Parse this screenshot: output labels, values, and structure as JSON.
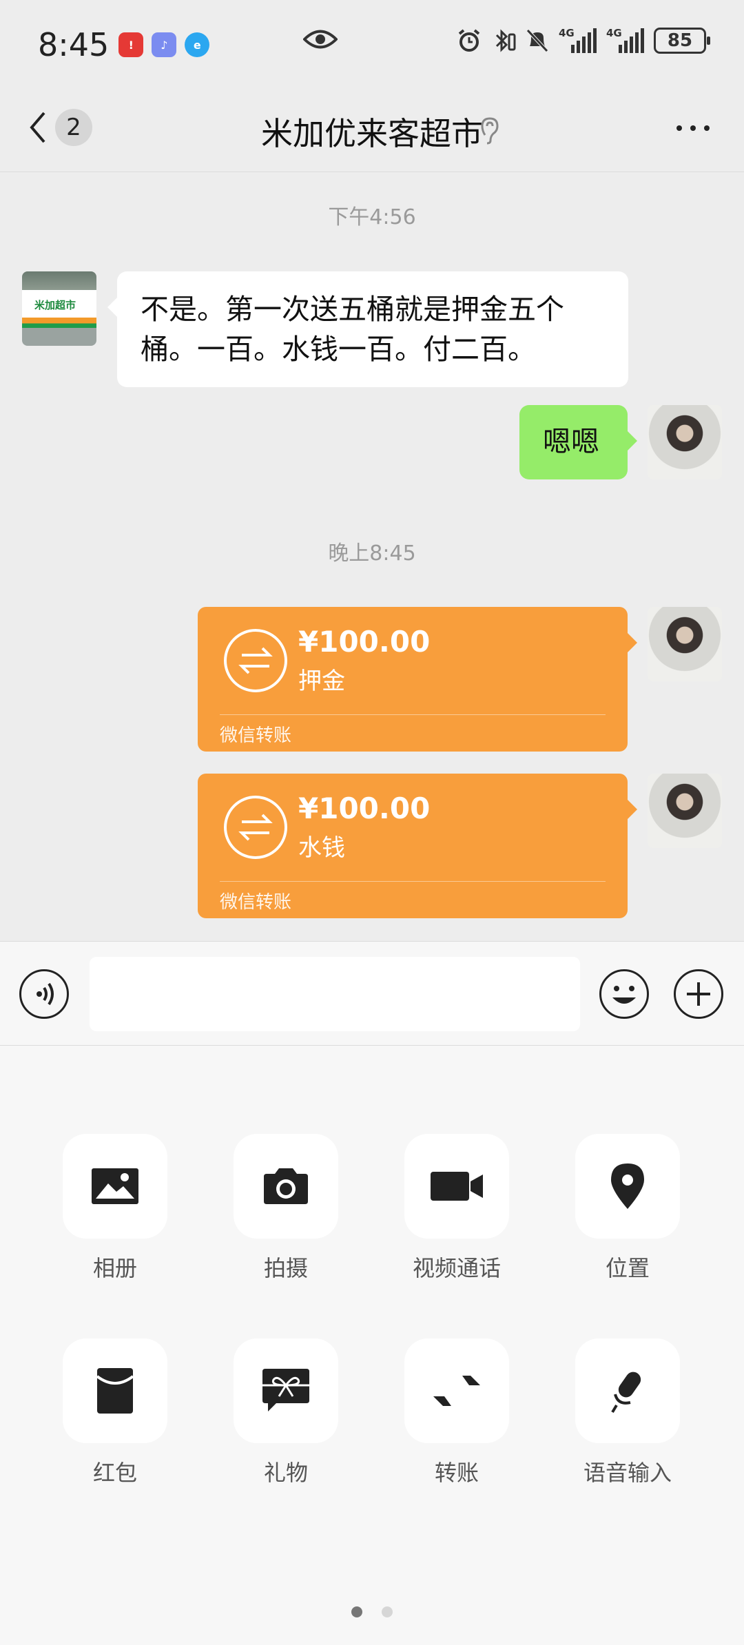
{
  "status_bar": {
    "time": "8:45",
    "signal1_label": "4G",
    "signal2_label": "4G",
    "battery": "85"
  },
  "header": {
    "unread_count": "2",
    "title": "米加优来客超市"
  },
  "chat": {
    "timestamp1": "下午4:56",
    "msg1": "不是。第一次送五桶就是押金五个桶。一百。水钱一百。付二百。",
    "msg2": "嗯嗯",
    "timestamp2": "晚上8:45",
    "store_avatar_sign": "米加超市",
    "transfers": [
      {
        "amount": "¥100.00",
        "note": "押金",
        "brand": "微信转账"
      },
      {
        "amount": "¥100.00",
        "note": "水钱",
        "brand": "微信转账"
      }
    ]
  },
  "input": {
    "value": "",
    "placeholder": ""
  },
  "panel": {
    "items": [
      {
        "label": "相册",
        "icon": "album-icon"
      },
      {
        "label": "拍摄",
        "icon": "camera-icon"
      },
      {
        "label": "视频通话",
        "icon": "video-call-icon"
      },
      {
        "label": "位置",
        "icon": "location-icon"
      },
      {
        "label": "红包",
        "icon": "red-packet-icon"
      },
      {
        "label": "礼物",
        "icon": "gift-icon"
      },
      {
        "label": "转账",
        "icon": "transfer-icon"
      },
      {
        "label": "语音输入",
        "icon": "voice-input-icon"
      }
    ],
    "page_count": 2,
    "active_page": 1
  },
  "colors": {
    "background": "#ededed",
    "sent_bubble": "#95ec69",
    "transfer": "#f89e3c",
    "panel": "#f7f7f7"
  }
}
